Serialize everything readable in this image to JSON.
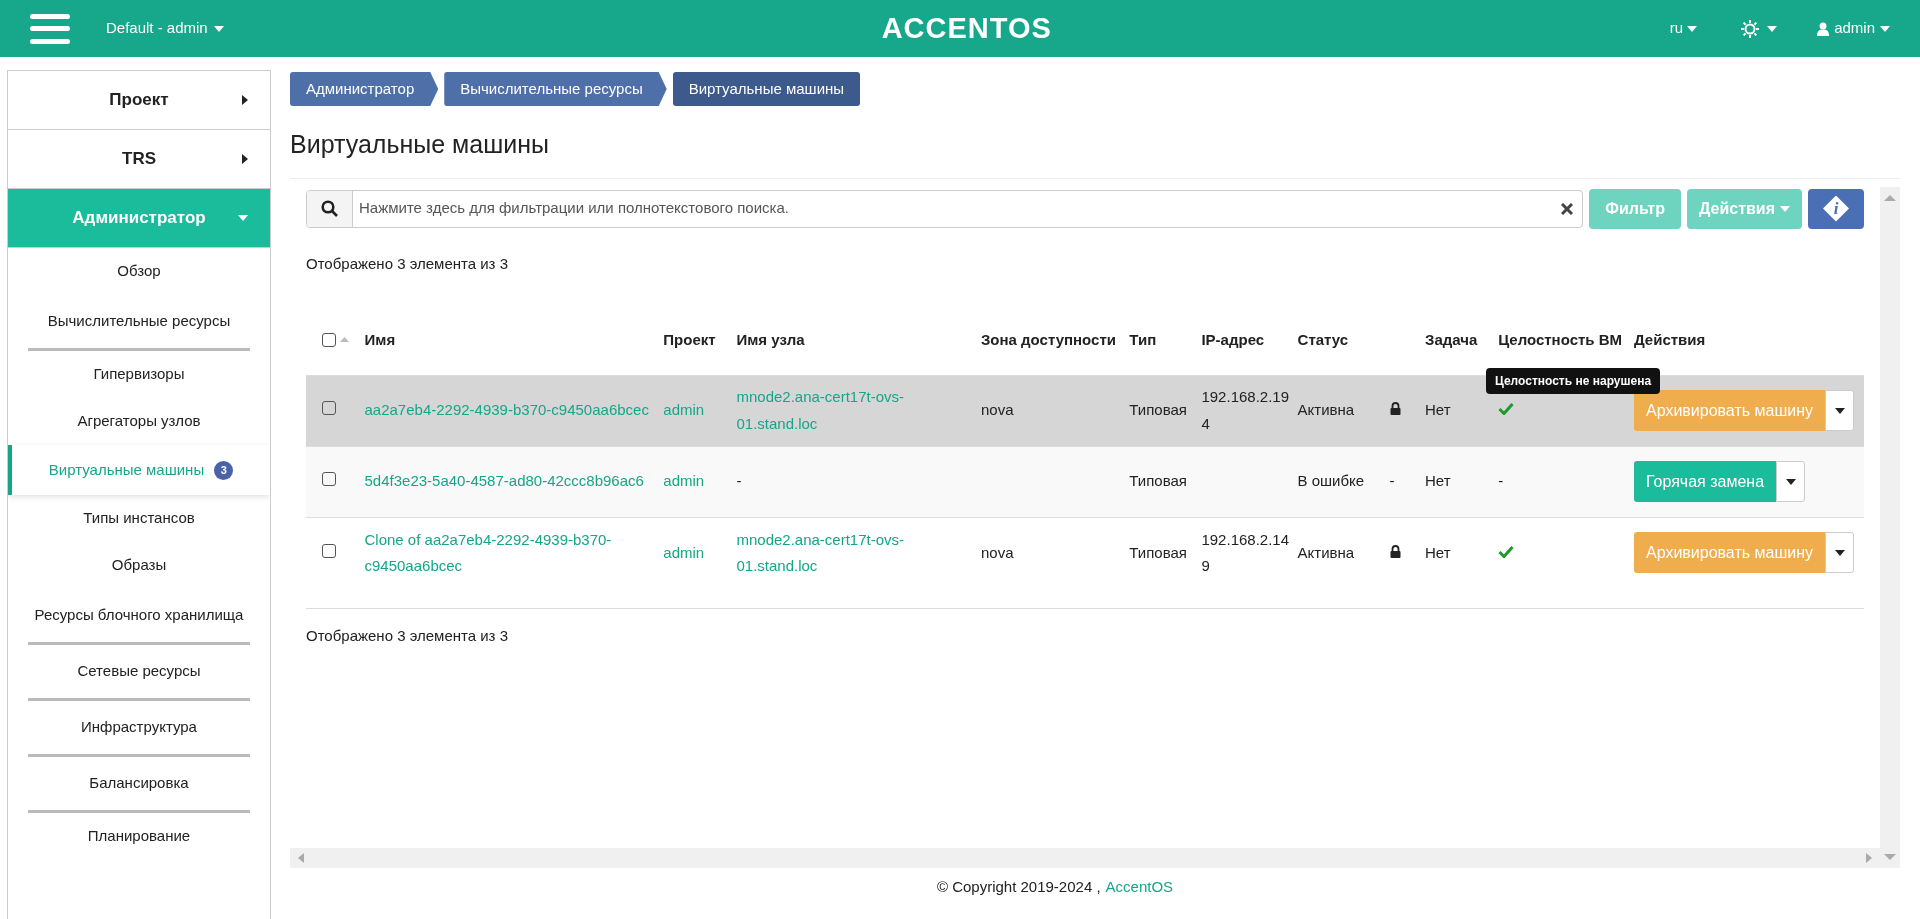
{
  "header": {
    "project_menu": "Default - admin",
    "logo": "ACCENTOS",
    "language": "ru",
    "user": "admin"
  },
  "sidebar": [
    {
      "label": "Проект",
      "expanded": false
    },
    {
      "label": "TRS",
      "expanded": false
    },
    {
      "label": "Администратор",
      "expanded": true,
      "children": [
        {
          "kind": "link",
          "label": "Обзор",
          "selected": false
        },
        {
          "kind": "group",
          "label": "Вычислительные ресурсы",
          "children": [
            {
              "kind": "link",
              "label": "Гипервизоры",
              "selected": false
            },
            {
              "kind": "link",
              "label": "Агрегаторы узлов",
              "selected": false
            },
            {
              "kind": "link",
              "label": "Виртуальные машины",
              "selected": true,
              "badge": "3"
            },
            {
              "kind": "link",
              "label": "Типы инстансов",
              "selected": false
            },
            {
              "kind": "link",
              "label": "Образы",
              "selected": false
            }
          ]
        },
        {
          "kind": "group",
          "label": "Ресурсы блочного хранилища"
        },
        {
          "kind": "group",
          "label": "Сетевые ресурсы"
        },
        {
          "kind": "group",
          "label": "Инфраструктура"
        },
        {
          "kind": "group",
          "label": "Балансировка"
        },
        {
          "kind": "link",
          "label": "Планирование",
          "selected": false
        }
      ]
    }
  ],
  "breadcrumb": [
    "Администратор",
    "Вычислительные ресурсы",
    "Виртуальные машины"
  ],
  "page_title": "Виртуальные машины",
  "search": {
    "placeholder": "Нажмите здесь для фильтрации или полнотекстового поиска."
  },
  "toolbar": {
    "filter": "Фильтр",
    "actions": "Действия",
    "info": "i"
  },
  "count_top": "Отображено 3 элемента из 3",
  "table": {
    "columns": [
      "Имя",
      "Проект",
      "Имя узла",
      "Зона доступности",
      "Тип",
      "IP-адрес",
      "Статус",
      "",
      "Задача",
      "Целостность ВМ",
      "Действия"
    ],
    "all_checked": false,
    "rows": [
      {
        "selected": true,
        "checked": false,
        "name": "aa2a7eb4-2292-4939-b370-c9450aa6bcec",
        "project": "admin",
        "host": "mnode2.ana-cert17t-ovs-01.stand.loc",
        "zone": "nova",
        "type": "Типовая",
        "ip": "192.168.2.194",
        "status": "Активна",
        "locked": true,
        "task": "Нет",
        "intact": true,
        "tooltip": "Целостность не нарушена",
        "action": {
          "kind": "archive",
          "label": "Архивировать машину"
        }
      },
      {
        "selected": false,
        "checked": false,
        "name": "5d4f3e23-5a40-4587-ad80-42ccc8b96ac6",
        "project": "admin",
        "host": "-",
        "zone": "",
        "type": "Типовая",
        "ip": "",
        "status": "В ошибке",
        "locked": false,
        "lock_text": "-",
        "task": "Нет",
        "intact": false,
        "integrity_text": "-",
        "action": {
          "kind": "hotswap",
          "label": "Горячая замена"
        }
      },
      {
        "selected": false,
        "checked": false,
        "name": "Clone of aa2a7eb4-2292-4939-b370-c9450aa6bcec",
        "project": "admin",
        "host": "mnode2.ana-cert17t-ovs-01.stand.loc",
        "zone": "nova",
        "type": "Типовая",
        "ip": "192.168.2.149",
        "status": "Активна",
        "locked": true,
        "task": "Нет",
        "intact": true,
        "action": {
          "kind": "archive",
          "label": "Архивировать машину"
        }
      }
    ]
  },
  "count_bottom": "Отображено 3 элемента из 3",
  "footer": {
    "copyright": "© Copyright 2019-2024 ,",
    "link": "AccentOS"
  }
}
